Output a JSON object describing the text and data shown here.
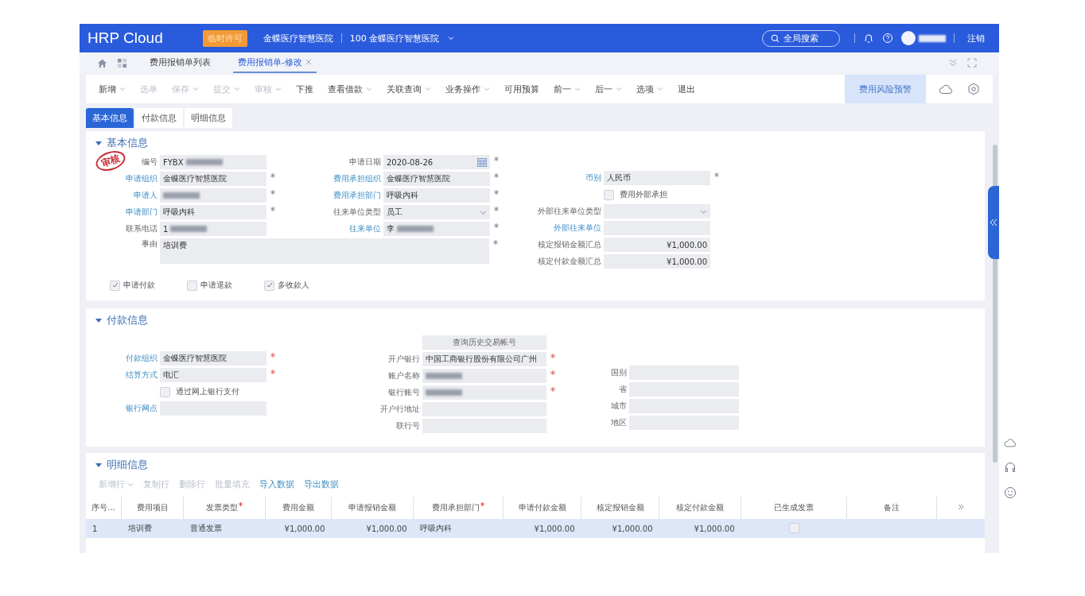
{
  "header": {
    "logo": "HRP Cloud",
    "badge": "临时许可",
    "org": "金蝶医疗智慧医院",
    "org_select": "100 金蝶医疗智慧医院",
    "search": {
      "placeholder": "全局搜索"
    },
    "logout": "注销"
  },
  "page_tabs": [
    {
      "label": "费用报销单列表",
      "selected": false,
      "closable": false
    },
    {
      "label": "费用报销单-修改",
      "selected": true,
      "closable": true
    }
  ],
  "toolbar": {
    "items": [
      {
        "label": "新增",
        "dropdown": true,
        "disabled": false
      },
      {
        "label": "选单",
        "dropdown": false,
        "disabled": true
      },
      {
        "label": "保存",
        "dropdown": true,
        "disabled": true
      },
      {
        "label": "提交",
        "dropdown": true,
        "disabled": true
      },
      {
        "label": "审核",
        "dropdown": true,
        "disabled": true
      },
      {
        "label": "下推",
        "dropdown": false,
        "disabled": false
      },
      {
        "label": "查看借款",
        "dropdown": true,
        "disabled": false
      },
      {
        "label": "关联查询",
        "dropdown": true,
        "disabled": false
      },
      {
        "label": "业务操作",
        "dropdown": true,
        "disabled": false
      },
      {
        "label": "可用预算",
        "dropdown": false,
        "disabled": false
      },
      {
        "label": "前一",
        "dropdown": true,
        "disabled": false
      },
      {
        "label": "后一",
        "dropdown": true,
        "disabled": false
      },
      {
        "label": "选项",
        "dropdown": true,
        "disabled": false
      },
      {
        "label": "退出",
        "dropdown": false,
        "disabled": false
      }
    ],
    "risk_button": "费用风险预警"
  },
  "section_tabs": [
    {
      "label": "基本信息",
      "selected": true
    },
    {
      "label": "付款信息",
      "selected": false
    },
    {
      "label": "明细信息",
      "selected": false
    }
  ],
  "basic": {
    "title": "基本信息",
    "stamp": "审核",
    "columns": [
      [
        {
          "kind": "text",
          "label": "编号",
          "value": "FYBX",
          "redacted": true,
          "required": false,
          "linked": false
        },
        {
          "kind": "text",
          "label": "申请组织",
          "value": "金蝶医疗智慧医院",
          "redacted": false,
          "required": true,
          "linked": true
        },
        {
          "kind": "text",
          "label": "申请人",
          "redacted": true,
          "required": true,
          "linked": true
        },
        {
          "kind": "text",
          "label": "申请部门",
          "value": "呼吸内科",
          "redacted": false,
          "required": true,
          "linked": true
        },
        {
          "kind": "text",
          "label": "联系电话",
          "value": "1",
          "redacted": true,
          "required": false,
          "linked": false
        }
      ],
      [
        {
          "kind": "date",
          "label": "申请日期",
          "value": "2020-08-26",
          "redacted": false,
          "required": true,
          "linked": false
        },
        {
          "kind": "text",
          "label": "费用承担组织",
          "value": "金蝶医疗智慧医院",
          "redacted": false,
          "required": true,
          "linked": true
        },
        {
          "kind": "text",
          "label": "费用承担部门",
          "value": "呼吸内科",
          "redacted": false,
          "required": true,
          "linked": true
        },
        {
          "kind": "select",
          "label": "往来单位类型",
          "value": "员工",
          "redacted": false,
          "required": true,
          "linked": false
        },
        {
          "kind": "text",
          "label": "往来单位",
          "value": "李",
          "redacted": true,
          "required": true,
          "linked": true
        }
      ]
    ],
    "reason": {
      "label": "事由",
      "value": "培训费",
      "required": true
    },
    "right": [
      {
        "kind": "text",
        "label": "币别",
        "value": "人民币",
        "redacted": false,
        "required": true,
        "linked": true
      },
      {
        "kind": "checkbox",
        "label": "费用外部承担",
        "checked": false
      },
      {
        "kind": "select",
        "label": "外部往来单位类型",
        "redacted": false,
        "required": false,
        "linked": false
      },
      {
        "kind": "text",
        "label": "外部往来单位",
        "redacted": false,
        "required": false,
        "linked": true
      },
      {
        "kind": "amount",
        "label": "核定报销金额汇总",
        "value": "¥1,000.00",
        "redacted": false,
        "required": false,
        "linked": false
      },
      {
        "kind": "amount",
        "label": "核定付款金额汇总",
        "value": "¥1,000.00",
        "redacted": false,
        "required": false,
        "linked": false
      }
    ],
    "options": [
      {
        "label": "申请付款",
        "checked": true
      },
      {
        "label": "申请退款",
        "checked": false
      },
      {
        "label": "多收款人",
        "checked": true
      }
    ]
  },
  "payment": {
    "title": "付款信息",
    "columns": [
      [
        {
          "kind": "text",
          "label": "付款组织",
          "value": "金蝶医疗智慧医院",
          "redacted": false,
          "required": true,
          "linked": true
        },
        {
          "kind": "text",
          "label": "结算方式",
          "value": "电汇",
          "redacted": false,
          "required": true,
          "linked": true
        },
        {
          "kind": "checkbox",
          "label": "通过网上银行支付",
          "checked": false
        },
        {
          "kind": "text",
          "label": "银行网点",
          "redacted": false,
          "required": false,
          "linked": true
        }
      ],
      [
        {
          "kind": "button",
          "label": "查询历史交易帐号"
        },
        {
          "kind": "text",
          "label": "开户银行",
          "value": "中国工商银行股份有限公司广州",
          "redacted": false,
          "required": true,
          "linked": false
        },
        {
          "kind": "text",
          "label": "账户名称",
          "redacted": true,
          "required": true,
          "linked": false
        },
        {
          "kind": "text",
          "label": "银行账号",
          "redacted": true,
          "required": true,
          "linked": false
        },
        {
          "kind": "text",
          "label": "开户行地址",
          "redacted": false,
          "required": false,
          "linked": false
        },
        {
          "kind": "text",
          "label": "联行号",
          "redacted": false,
          "required": false,
          "linked": false
        }
      ],
      [
        {
          "kind": "text",
          "label": "国别",
          "redacted": false,
          "required": false,
          "linked": false
        },
        {
          "kind": "text",
          "label": "省",
          "redacted": false,
          "required": false,
          "linked": false
        },
        {
          "kind": "text",
          "label": "城市",
          "redacted": false,
          "required": false,
          "linked": false
        },
        {
          "kind": "text",
          "label": "地区",
          "redacted": false,
          "required": false,
          "linked": false
        }
      ]
    ]
  },
  "detail": {
    "title": "明细信息",
    "actions": [
      {
        "label": "新增行",
        "dropdown": true,
        "disabled": true
      },
      {
        "label": "复制行",
        "dropdown": false,
        "disabled": true
      },
      {
        "label": "删除行",
        "dropdown": false,
        "disabled": true
      },
      {
        "label": "批量填充",
        "dropdown": false,
        "disabled": true
      },
      {
        "label": "导入数据",
        "dropdown": false,
        "disabled": false
      },
      {
        "label": "导出数据",
        "dropdown": false,
        "disabled": false
      }
    ],
    "columns": [
      {
        "label": "序号...",
        "required": false
      },
      {
        "label": "费用项目",
        "required": false
      },
      {
        "label": "发票类型",
        "required": true
      },
      {
        "label": "费用金额",
        "required": false
      },
      {
        "label": "申请报销金额",
        "required": false
      },
      {
        "label": "费用承担部门",
        "required": true
      },
      {
        "label": "申请付款金额",
        "required": false
      },
      {
        "label": "核定报销金额",
        "required": false
      },
      {
        "label": "核定付款金额",
        "required": false
      },
      {
        "label": "已生成发票",
        "required": false
      },
      {
        "label": "备注",
        "required": false
      }
    ],
    "rows": [
      {
        "selected": true,
        "invoiced": false,
        "cells": [
          "1",
          "培训费",
          "普通发票",
          "¥1,000.00",
          "¥1,000.00",
          "呼吸内科",
          "¥1,000.00",
          "¥1,000.00",
          "¥1,000.00"
        ]
      }
    ]
  }
}
